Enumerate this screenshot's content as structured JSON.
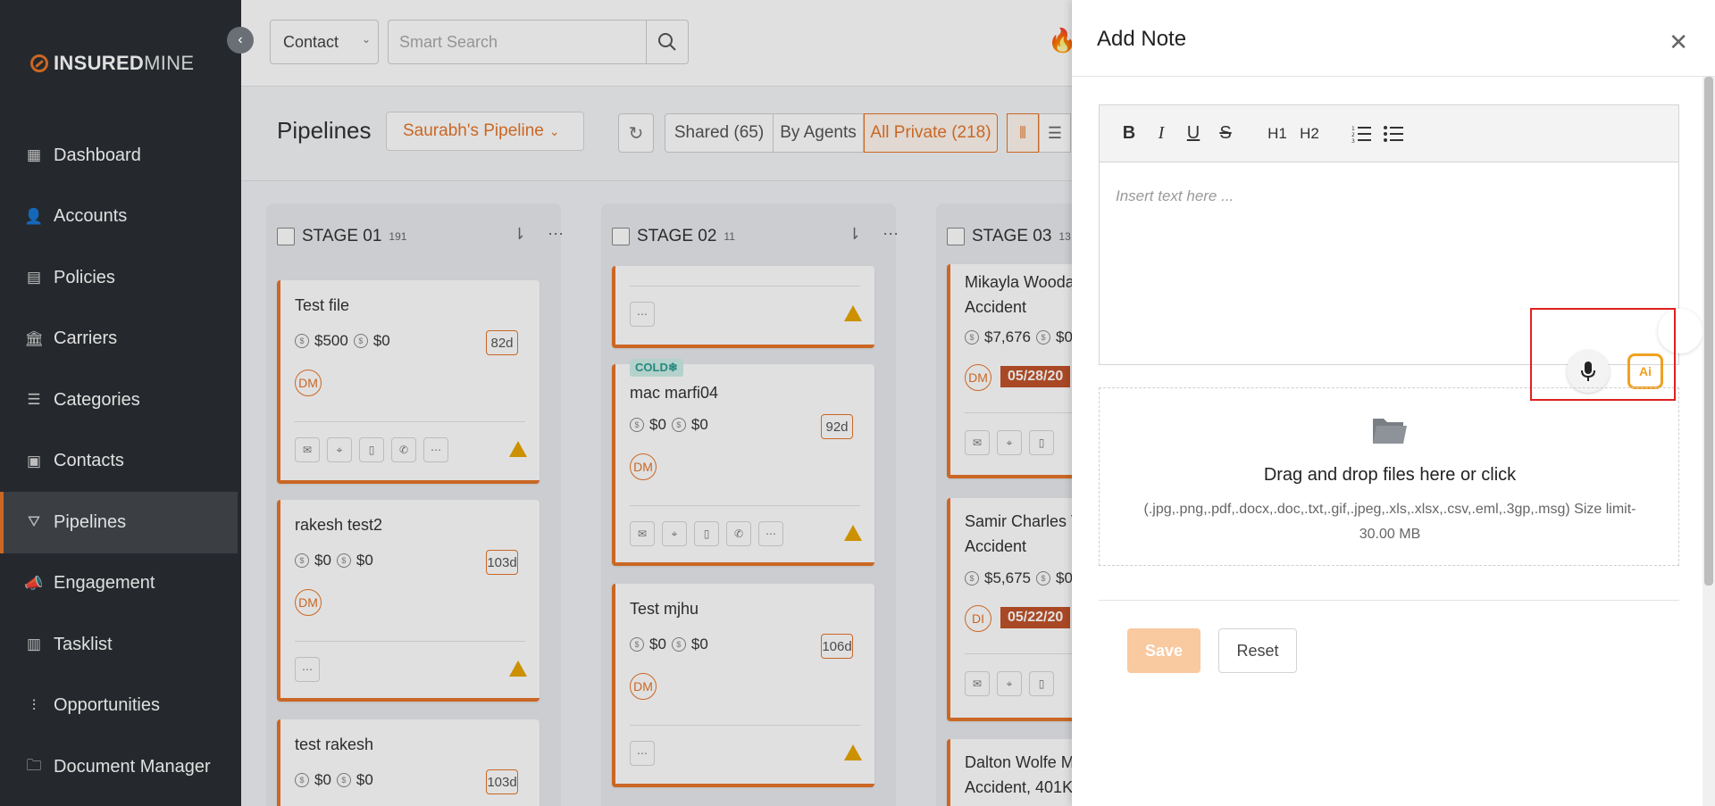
{
  "brand": {
    "name_bold": "INSURED",
    "name_light": "MINE"
  },
  "sidebar": {
    "items": [
      {
        "label": "Dashboard",
        "icon": "dashboard-icon",
        "glyph": "▦"
      },
      {
        "label": "Accounts",
        "icon": "accounts-icon",
        "glyph": "👤"
      },
      {
        "label": "Policies",
        "icon": "policies-icon",
        "glyph": "▤"
      },
      {
        "label": "Carriers",
        "icon": "carriers-icon",
        "glyph": "🏛"
      },
      {
        "label": "Categories",
        "icon": "categories-icon",
        "glyph": "☰"
      },
      {
        "label": "Contacts",
        "icon": "contacts-icon",
        "glyph": "▣"
      },
      {
        "label": "Pipelines",
        "icon": "pipelines-icon",
        "glyph": "⛛",
        "active": true
      },
      {
        "label": "Engagement",
        "icon": "engagement-icon",
        "glyph": "📣"
      },
      {
        "label": "Tasklist",
        "icon": "tasklist-icon",
        "glyph": "▥"
      },
      {
        "label": "Opportunities",
        "icon": "opportunities-icon",
        "glyph": "⫶"
      },
      {
        "label": "Document Manager",
        "icon": "folder-icon",
        "glyph": "🗀"
      }
    ]
  },
  "header": {
    "contact_select": "Contact",
    "search_placeholder": "Smart Search"
  },
  "pipeline": {
    "title": "Pipelines",
    "selected_pipeline": "Saurabh's Pipeline",
    "filters": [
      {
        "label": "Shared (65)"
      },
      {
        "label": "By Agents"
      },
      {
        "label": "All Private (218)",
        "active": true
      }
    ],
    "stages": [
      {
        "label": "STAGE 01",
        "count": "191",
        "cards": [
          {
            "title": "Test file",
            "amount1": "$500",
            "amount2": "$0",
            "days": "82d",
            "avatar": "DM"
          },
          {
            "title": "rakesh test2",
            "amount1": "$0",
            "amount2": "$0",
            "days": "103d",
            "avatar": "DM"
          },
          {
            "title": "test rakesh",
            "amount1": "$0",
            "amount2": "$0",
            "days": "103d"
          }
        ]
      },
      {
        "label": "STAGE 02",
        "count": "11",
        "cards": [
          {
            "tag": "COLD❄",
            "title": "mac marfi04",
            "amount1": "$0",
            "amount2": "$0",
            "days": "92d",
            "avatar": "DM"
          },
          {
            "title": "Test mjhu",
            "amount1": "$0",
            "amount2": "$0",
            "days": "106d",
            "avatar": "DM"
          }
        ]
      },
      {
        "label": "STAGE 03",
        "count": "13",
        "cards": [
          {
            "title": "Mikayla Wooda",
            "subtitle": "Accident",
            "amount1": "$7,676",
            "amount2": "$0",
            "avatar": "DM",
            "date": "05/28/20"
          },
          {
            "title": "Samir Charles V",
            "subtitle": "Accident",
            "amount1": "$5,675",
            "amount2": "$0",
            "avatar": "DI",
            "date": "05/22/20"
          },
          {
            "title": "Dalton Wolfe M",
            "subtitle": "Accident, 401K"
          }
        ]
      }
    ]
  },
  "modal": {
    "title": "Add Note",
    "editor_placeholder": "Insert text here ...",
    "toolbar": [
      "B",
      "I",
      "U",
      "S",
      "H1",
      "H2"
    ],
    "ai_label": "Ai",
    "dropzone_title": "Drag and drop files here or click",
    "dropzone_hint": "(.jpg,.png,.pdf,.docx,.doc,.txt,.gif,.jpeg,.xls,.xlsx,.csv,.eml,.3gp,.msg) Size limit- 30.00 MB",
    "save_label": "Save",
    "reset_label": "Reset"
  },
  "colors": {
    "accent": "#e6762a",
    "sidebar": "#2b2f34",
    "date_tag": "#c1532a",
    "highlight": "#e02020"
  }
}
